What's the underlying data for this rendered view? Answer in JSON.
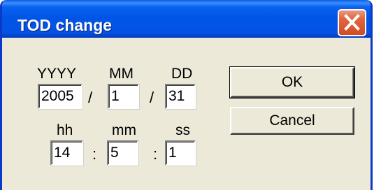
{
  "window": {
    "title": "TOD change",
    "icons": {
      "close": "close-icon"
    },
    "colors": {
      "titlebar": "#0155e6",
      "close": "#d24a22",
      "face": "#ece9d8"
    }
  },
  "date": {
    "year_label": "YYYY",
    "month_label": "MM",
    "day_label": "DD",
    "year_value": "2005",
    "month_value": "1",
    "day_value": "31",
    "separator": "/"
  },
  "time": {
    "hour_label": "hh",
    "minute_label": "mm",
    "second_label": "ss",
    "hour_value": "14",
    "minute_value": "5",
    "second_value": "1",
    "separator": ":"
  },
  "buttons": {
    "ok": "OK",
    "cancel": "Cancel"
  }
}
